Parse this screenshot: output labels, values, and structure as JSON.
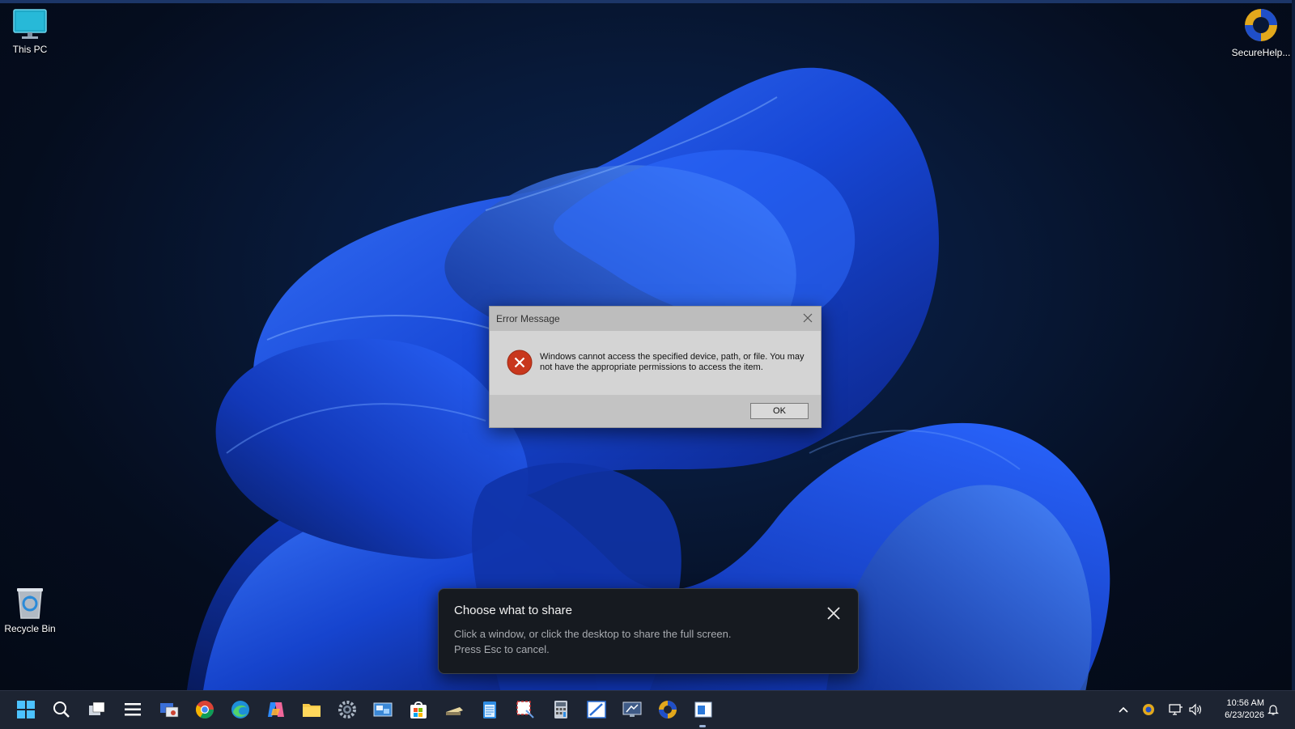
{
  "desktop": {
    "icons": {
      "this_pc": "This PC",
      "recycle_bin": "Recycle Bin",
      "securehelp": "SecureHelp..."
    }
  },
  "error_dialog": {
    "title": "Error Message",
    "message": "Windows cannot access the specified device, path, or file. You may not have the appropriate permissions to access the item.",
    "ok_label": "OK"
  },
  "share_toast": {
    "heading": "Choose what to share",
    "line1": "Click a window, or click the desktop to share the full screen.",
    "line2": "Press Esc to cancel."
  },
  "taskbar": {
    "apps": [
      "start-icon",
      "search-icon",
      "task-view-icon",
      "menu-icon",
      "remote-app-icon",
      "chrome-icon",
      "edge-icon",
      "copilot-icon",
      "file-explorer-icon",
      "settings-icon",
      "control-panel-icon",
      "store-icon",
      "scanner-icon",
      "notepad-icon",
      "snipping-tool-icon",
      "calculator-icon",
      "paint-icon",
      "remote-desktop-icon",
      "securehelp-icon",
      "window-app-icon"
    ]
  },
  "tray": {
    "time": "10:56 AM",
    "date": "6/23/2026"
  },
  "colors": {
    "accent": "#0a64d6",
    "error_red": "#c8371d"
  }
}
